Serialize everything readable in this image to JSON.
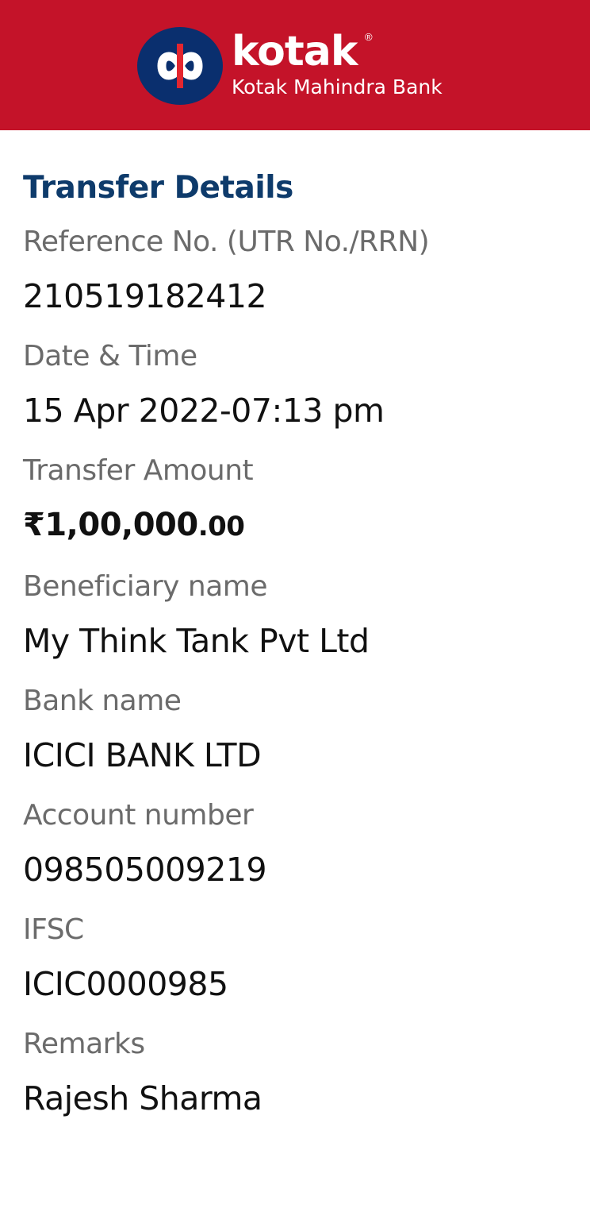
{
  "header": {
    "brand": "kotak",
    "registered_mark": "®",
    "bank_name": "Kotak Mahindra Bank",
    "brand_color": "#c41329",
    "logo_icon": "kotak-infinity-logo"
  },
  "section_title": "Transfer Details",
  "fields": {
    "reference": {
      "label": "Reference No. (UTR No./RRN)",
      "value": "210519182412"
    },
    "datetime": {
      "label": "Date & Time",
      "value": "15 Apr 2022-07:13 pm"
    },
    "amount": {
      "label": "Transfer Amount",
      "value_main": "₹1,00,000",
      "value_paise": ".00"
    },
    "beneficiary": {
      "label": "Beneficiary name",
      "value": "My Think Tank Pvt Ltd"
    },
    "bank": {
      "label": "Bank name",
      "value": "ICICI BANK LTD"
    },
    "account": {
      "label": "Account number",
      "value": "098505009219"
    },
    "ifsc": {
      "label": "IFSC",
      "value": "ICIC0000985"
    },
    "remarks": {
      "label": "Remarks",
      "value": "Rajesh Sharma"
    }
  },
  "colors": {
    "title": "#0e3b6b",
    "label": "#6b6b6b",
    "value": "#111111",
    "logo_blue": "#0a2f6e"
  }
}
